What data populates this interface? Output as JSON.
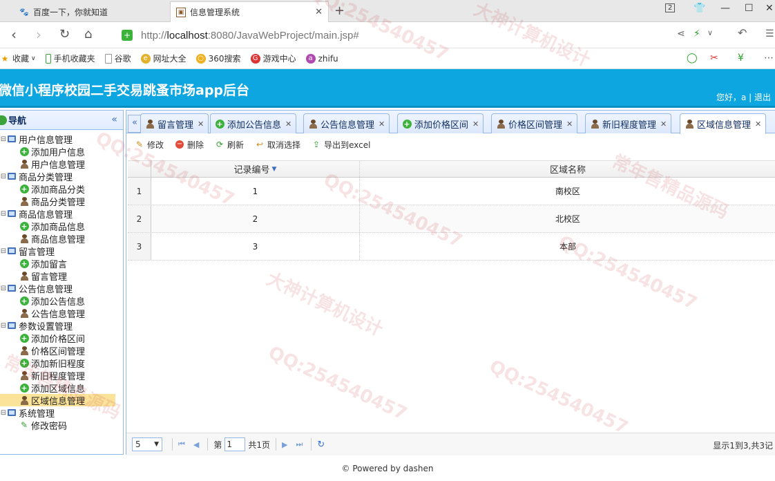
{
  "browser": {
    "tabs": [
      {
        "title": "百度一下，你就知道"
      },
      {
        "title": "信息管理系统"
      }
    ],
    "tab_count": "2",
    "url": {
      "prefix": "http://",
      "host": "localhost",
      "rest": ":8080/JavaWebProject/main.jsp#"
    },
    "bookmarks": [
      "收藏",
      "手机收藏夹",
      "谷歌",
      "网址大全",
      "360搜索",
      "游戏中心",
      "zhifu"
    ]
  },
  "app": {
    "title": "微信小程序校园二手交易跳蚤市场app后台",
    "greeting": "您好，a | 退出"
  },
  "sidebar": {
    "title": "导航",
    "groups": [
      {
        "label": "用户信息管理",
        "items": [
          "添加用户信息",
          "用户信息管理"
        ]
      },
      {
        "label": "商品分类管理",
        "items": [
          "添加商品分类",
          "商品分类管理"
        ]
      },
      {
        "label": "商品信息管理",
        "items": [
          "添加商品信息",
          "商品信息管理"
        ]
      },
      {
        "label": "留言管理",
        "items": [
          "添加留言",
          "留言管理"
        ]
      },
      {
        "label": "公告信息管理",
        "items": [
          "添加公告信息",
          "公告信息管理"
        ]
      },
      {
        "label": "参数设置管理",
        "items": [
          "添加价格区间",
          "价格区间管理",
          "添加新旧程度",
          "新旧程度管理",
          "添加区域信息",
          "区域信息管理"
        ]
      },
      {
        "label": "系统管理",
        "items": [
          "修改密码"
        ]
      }
    ]
  },
  "main": {
    "tabs": [
      "留言管理",
      "添加公告信息",
      "公告信息管理",
      "添加价格区间",
      "价格区间管理",
      "新旧程度管理",
      "区域信息管理"
    ],
    "toolbar": {
      "edit": "修改",
      "delete": "删除",
      "refresh": "刷新",
      "cancel_select": "取消选择",
      "export": "导出到excel"
    },
    "grid": {
      "columns": [
        "记录编号",
        "区域名称"
      ],
      "rows": [
        {
          "num": "1",
          "id": "1",
          "name": "南校区"
        },
        {
          "num": "2",
          "id": "2",
          "name": "北校区"
        },
        {
          "num": "3",
          "id": "3",
          "name": "本部"
        }
      ]
    },
    "pager": {
      "page_size": "5",
      "page_label": "第",
      "page_value": "1",
      "total_pages": "共1页",
      "info": "显示1到3,共3记"
    }
  },
  "footer": "© Powered by dashen",
  "watermark": {
    "contact": "QQ:254540457",
    "slogan1": "大神计算机设计",
    "slogan2": "常年售精品源码"
  }
}
